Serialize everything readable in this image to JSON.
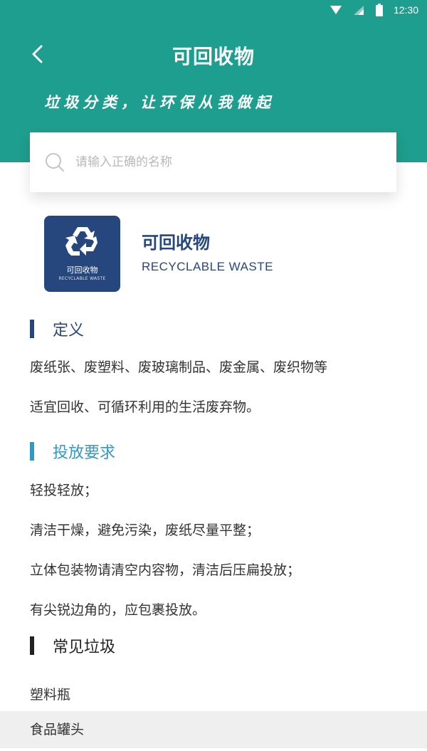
{
  "status_bar": {
    "time": "12:30"
  },
  "header": {
    "title": "可回收物",
    "slogan": "垃圾分类，让环保从我做起"
  },
  "search": {
    "placeholder": "请输入正确的名称"
  },
  "category": {
    "logo_cn": "可回收物",
    "logo_en": "RECYCLABLE WASTE",
    "name": "可回收物",
    "name_en": "RECYCLABLE WASTE"
  },
  "definition": {
    "title": "定义",
    "lines": [
      "废纸张、废塑料、废玻璃制品、废金属、废织物等",
      "适宜回收、可循环利用的生活废弃物。"
    ]
  },
  "disposal": {
    "title": "投放要求",
    "lines": [
      "轻投轻放；",
      "清洁干燥，避免污染，废纸尽量平整；",
      "立体包装物请清空内容物，清洁后压扁投放；",
      "有尖锐边角的，应包裹投放。"
    ]
  },
  "common": {
    "title": "常见垃圾",
    "items": [
      "塑料瓶",
      "食品罐头"
    ]
  },
  "colors": {
    "header": "#1e9e8e",
    "category": "#26477e",
    "disposal_accent": "#2f9ac4"
  }
}
